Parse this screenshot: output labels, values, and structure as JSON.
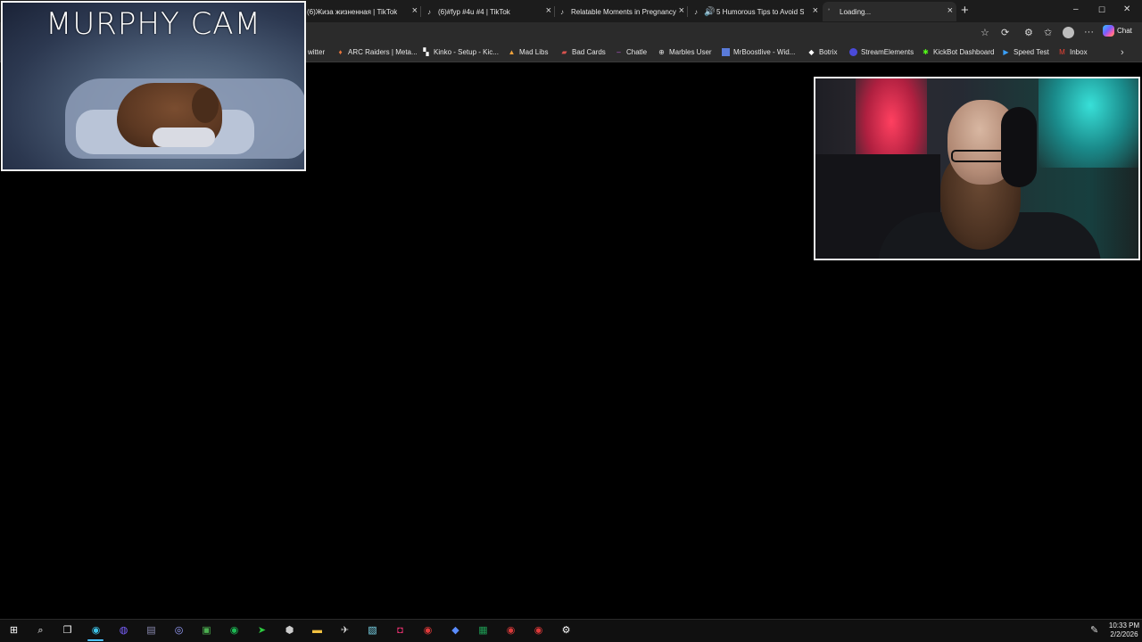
{
  "tabs": [
    {
      "title": "(6)Жиза жизненная | TikTok",
      "icon": "tiktok-icon",
      "close": "×"
    },
    {
      "title": "(6)#fyp #4u #4 | TikTok",
      "icon": "tiktok-icon",
      "close": "×"
    },
    {
      "title": "Relatable Moments in Pregnancy:",
      "icon": "tiktok-icon",
      "close": "×"
    },
    {
      "title": "5 Humorous Tips to Avoid Ser",
      "icon": "tiktok-icon",
      "close": "×",
      "muted_icon": "speaker-icon"
    },
    {
      "title": "Loading...",
      "icon": "loading-icon",
      "close": "×"
    }
  ],
  "new_tab": "+",
  "window_controls": {
    "minimize": "–",
    "maximize": "☐",
    "close": "✕"
  },
  "toolbar": {
    "chat_label": "Chat"
  },
  "bookmarks": [
    {
      "label": "witter",
      "icon": "twitter-icon"
    },
    {
      "label": "ARC Raiders | Meta...",
      "icon": "arc-raiders-icon",
      "color": "#e8743b"
    },
    {
      "label": "Kinko - Setup - Kic...",
      "icon": "kinko-icon",
      "color": "#ffffff"
    },
    {
      "label": "Mad Libs",
      "icon": "mad-libs-icon",
      "color": "#f0a23b"
    },
    {
      "label": "Bad Cards",
      "icon": "bad-cards-icon",
      "color": "#d9534f"
    },
    {
      "label": "Chatle",
      "icon": "chatle-icon",
      "color": "#c25ad9"
    },
    {
      "label": "Marbles User",
      "icon": "globe-icon",
      "color": "#dddddd"
    },
    {
      "label": "MrBoostlive - Wid...",
      "icon": "mrboost-icon",
      "color": "#5a7bd9"
    },
    {
      "label": "Botrix",
      "icon": "botrix-icon",
      "color": "#ffffff"
    },
    {
      "label": "StreamElements",
      "icon": "streamelements-icon",
      "color": "#4a4ad9"
    },
    {
      "label": "KickBot Dashboard",
      "icon": "kickbot-icon",
      "color": "#53fc18"
    },
    {
      "label": "Speed Test",
      "icon": "speedtest-icon",
      "color": "#3aa0ff"
    },
    {
      "label": "Inbox",
      "icon": "gmail-icon",
      "color": "#ea4335"
    }
  ],
  "overlay": {
    "murphy_title": "MURPHY CAM"
  },
  "taskbar": {
    "time": "10:33 PM",
    "date": "2/2/2026",
    "apps": [
      {
        "name": "start-icon",
        "color": "#ffffff"
      },
      {
        "name": "search-icon",
        "color": "#ffffff"
      },
      {
        "name": "task-view-icon",
        "color": "#ffffff"
      },
      {
        "name": "edge-icon",
        "color": "#3ec3e8"
      },
      {
        "name": "chrome-icon",
        "color": "#7b61ff"
      },
      {
        "name": "app-icon-1",
        "color": "#8a8ab0"
      },
      {
        "name": "discord-icon",
        "color": "#9aa0ff"
      },
      {
        "name": "minecraft-icon",
        "color": "#4caf50"
      },
      {
        "name": "spotify-icon",
        "color": "#1db954"
      },
      {
        "name": "app-icon-green",
        "color": "#2ecc40"
      },
      {
        "name": "obs-icon",
        "color": "#cccccc"
      },
      {
        "name": "file-explorer-icon",
        "color": "#f0c040"
      },
      {
        "name": "app-icon-bird",
        "color": "#d0d0d0"
      },
      {
        "name": "notepad-icon",
        "color": "#79d2e6"
      },
      {
        "name": "instagram-icon",
        "color": "#e1306c"
      },
      {
        "name": "app-icon-red-1",
        "color": "#e03a3a"
      },
      {
        "name": "app-icon-blue",
        "color": "#5a8cff"
      },
      {
        "name": "excel-icon",
        "color": "#1f9d55"
      },
      {
        "name": "app-icon-red-2",
        "color": "#d93a3a"
      },
      {
        "name": "app-icon-red-3",
        "color": "#e03a3a"
      },
      {
        "name": "settings-icon",
        "color": "#ffffff"
      }
    ]
  }
}
